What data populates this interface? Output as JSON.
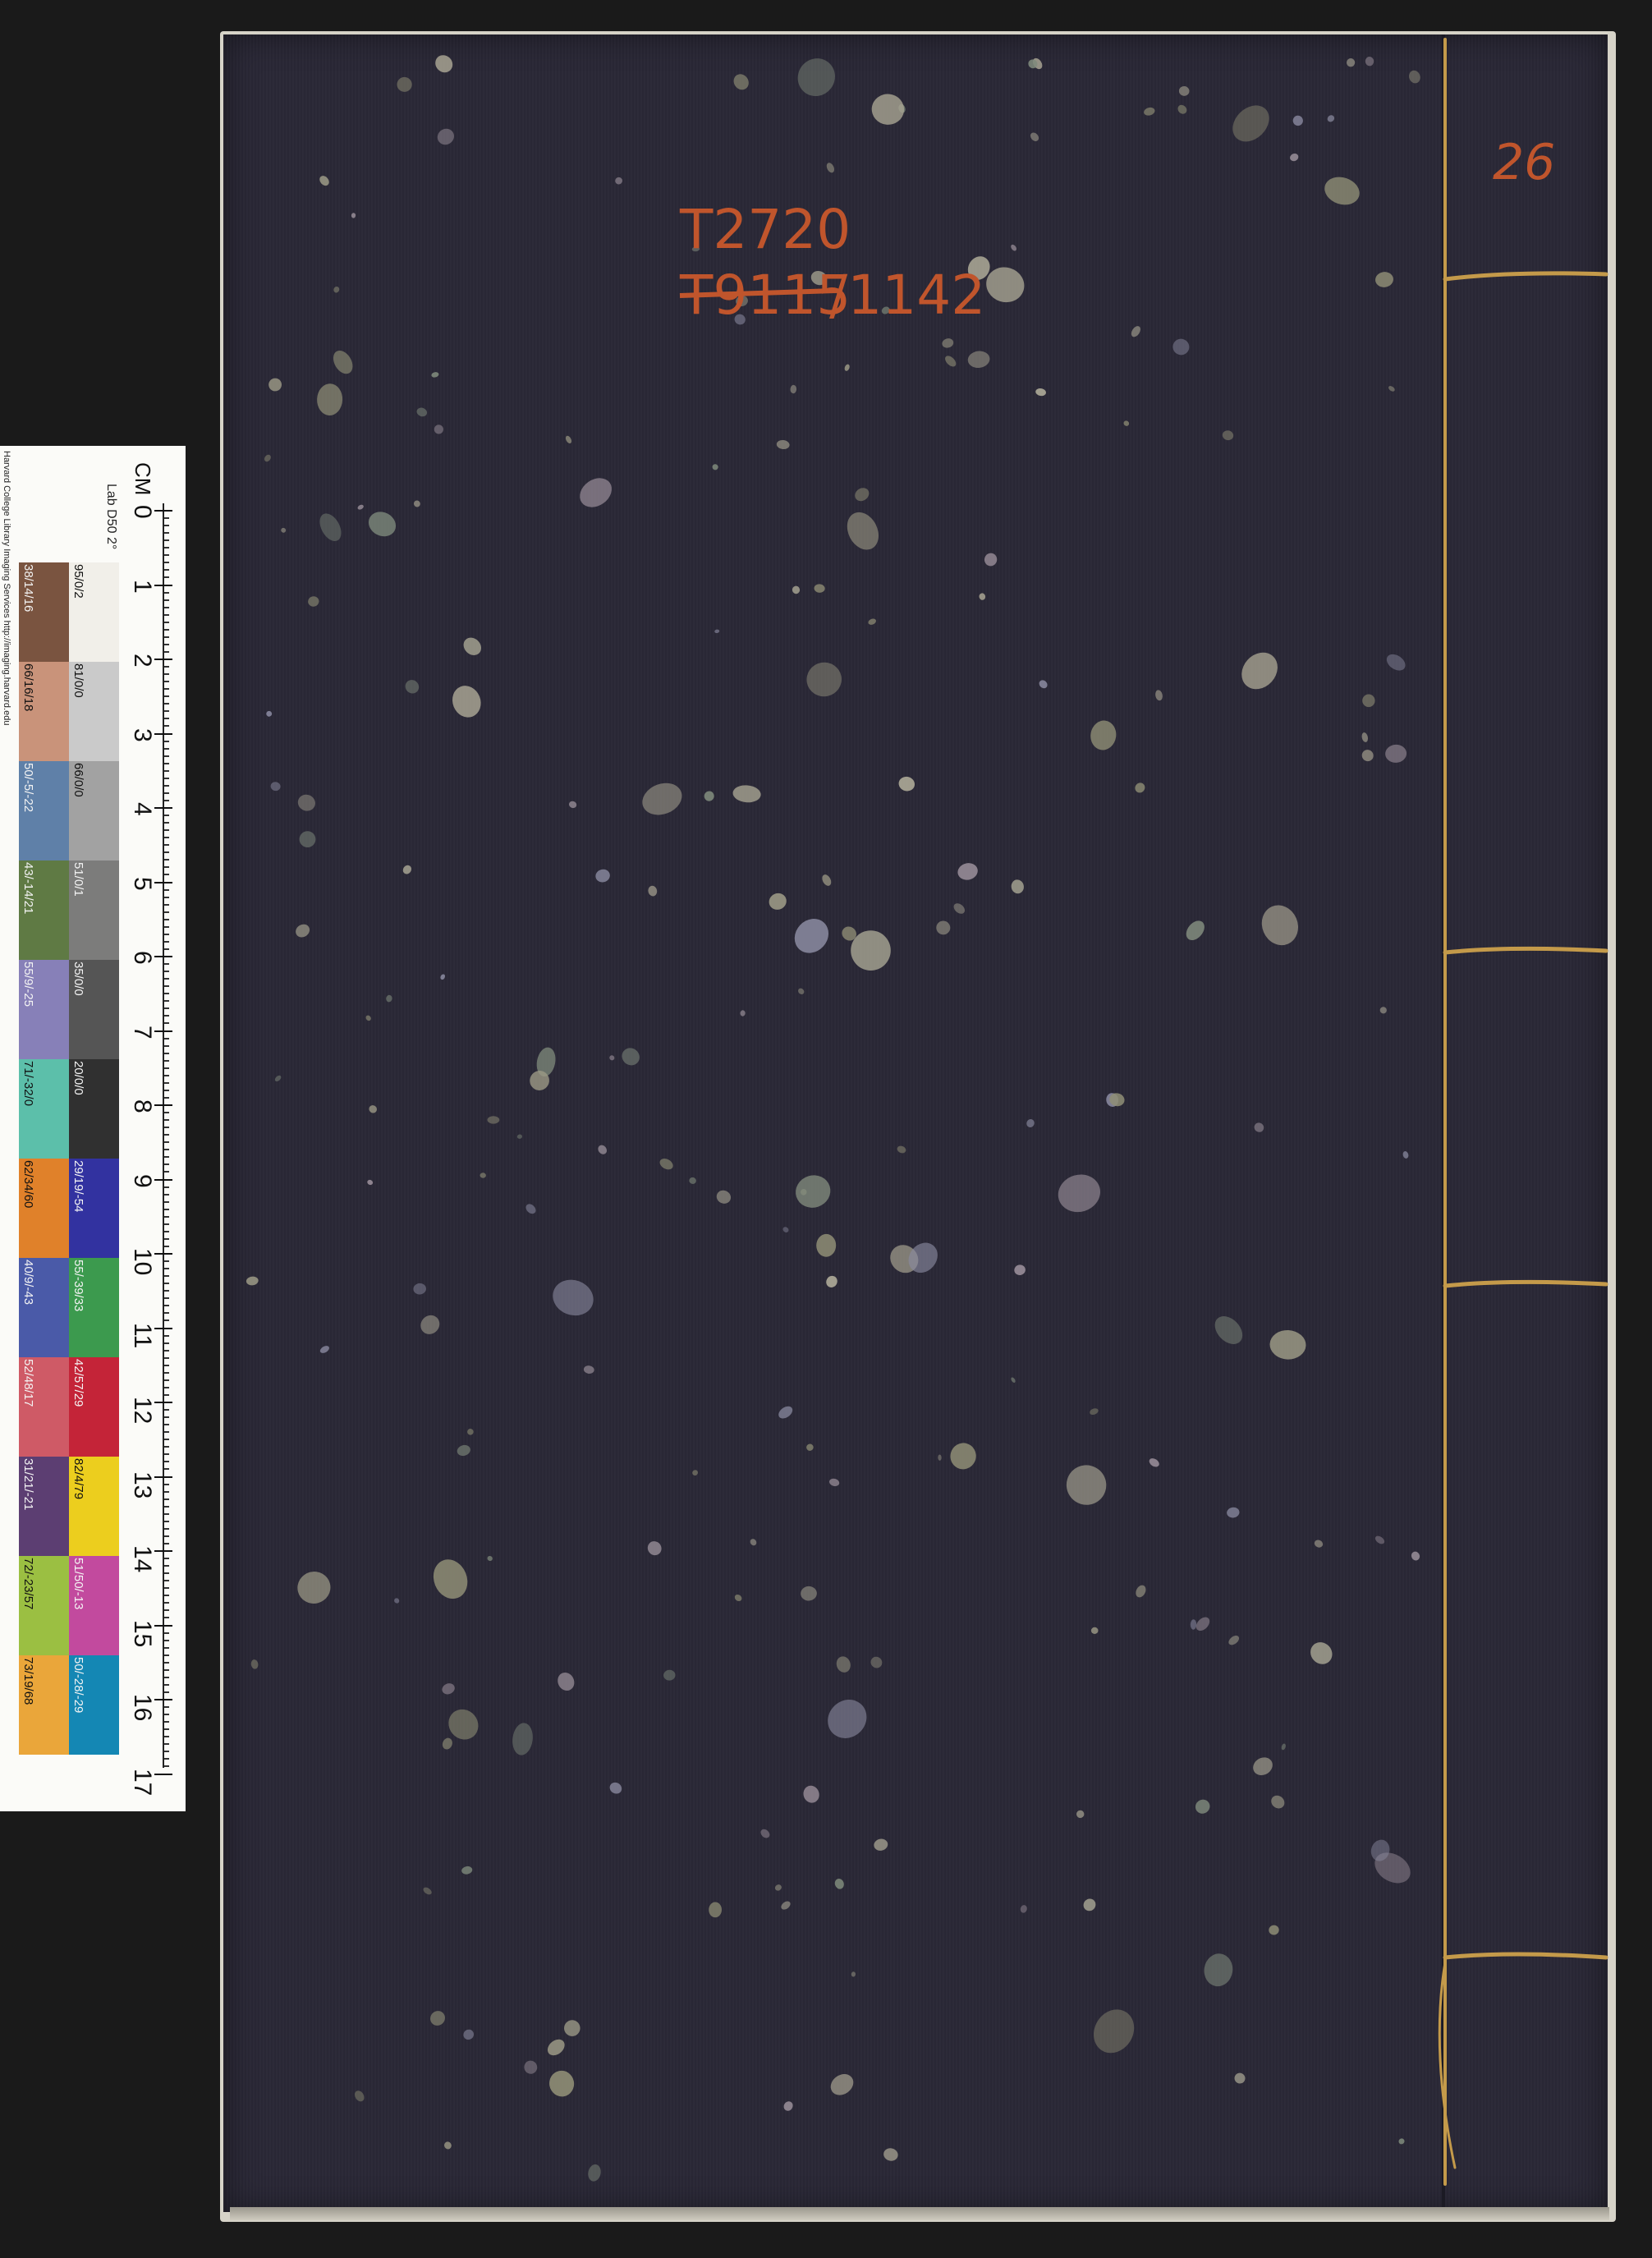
{
  "book": {
    "shelf_mark_line1": "T2720",
    "shelf_mark_struck": "T9115",
    "shelf_mark_suffix": "/1142",
    "volume_number": "26",
    "colors": {
      "cover": "#2a2836",
      "thread": "#c49a4a",
      "ink": "#c0552c"
    }
  },
  "target": {
    "credit": "Harvard College Library Imaging Services http://imaging.harvard.edu",
    "ruler_title": "CM",
    "lab_label": "Lab D50 2°",
    "cm_labels": [
      "0",
      "1",
      "2",
      "3",
      "4",
      "5",
      "6",
      "7",
      "8",
      "9",
      "10",
      "11",
      "12",
      "13",
      "14",
      "15",
      "16",
      "17"
    ],
    "swatches_left": [
      {
        "label": "38/14/16",
        "color": "#7a5440"
      },
      {
        "label": "66/16/18",
        "color": "#c9937a"
      },
      {
        "label": "50/-5/-22",
        "color": "#5f80a8"
      },
      {
        "label": "43/-14/21",
        "color": "#5f7a44"
      },
      {
        "label": "55/9/-25",
        "color": "#8780b8"
      },
      {
        "label": "71/-32/0",
        "color": "#5cbfaa"
      },
      {
        "label": "62/34/60",
        "color": "#e0812a"
      },
      {
        "label": "40/9/-43",
        "color": "#4a5aa8"
      },
      {
        "label": "52/48/17",
        "color": "#cf5a66"
      },
      {
        "label": "31/21/-21",
        "color": "#5c3e72"
      },
      {
        "label": "72/-23/57",
        "color": "#9bbf42"
      },
      {
        "label": "73/19/68",
        "color": "#eaa63a"
      }
    ],
    "swatches_right": [
      {
        "label": "95/0/2",
        "color": "#f1efe9"
      },
      {
        "label": "81/0/0",
        "color": "#cacaca"
      },
      {
        "label": "66/0/0",
        "color": "#a2a2a2"
      },
      {
        "label": "51/0/1",
        "color": "#7c7c7b"
      },
      {
        "label": "35/0/0",
        "color": "#555555"
      },
      {
        "label": "20/0/0",
        "color": "#303030"
      },
      {
        "label": "29/19/-54",
        "color": "#3232a0"
      },
      {
        "label": "55/-39/33",
        "color": "#3c9a4e"
      },
      {
        "label": "42/57/29",
        "color": "#c42438"
      },
      {
        "label": "82/4/79",
        "color": "#ecce1e"
      },
      {
        "label": "51/50/-13",
        "color": "#c24a9e"
      },
      {
        "label": "50/-28/-29",
        "color": "#1487b4"
      }
    ]
  }
}
